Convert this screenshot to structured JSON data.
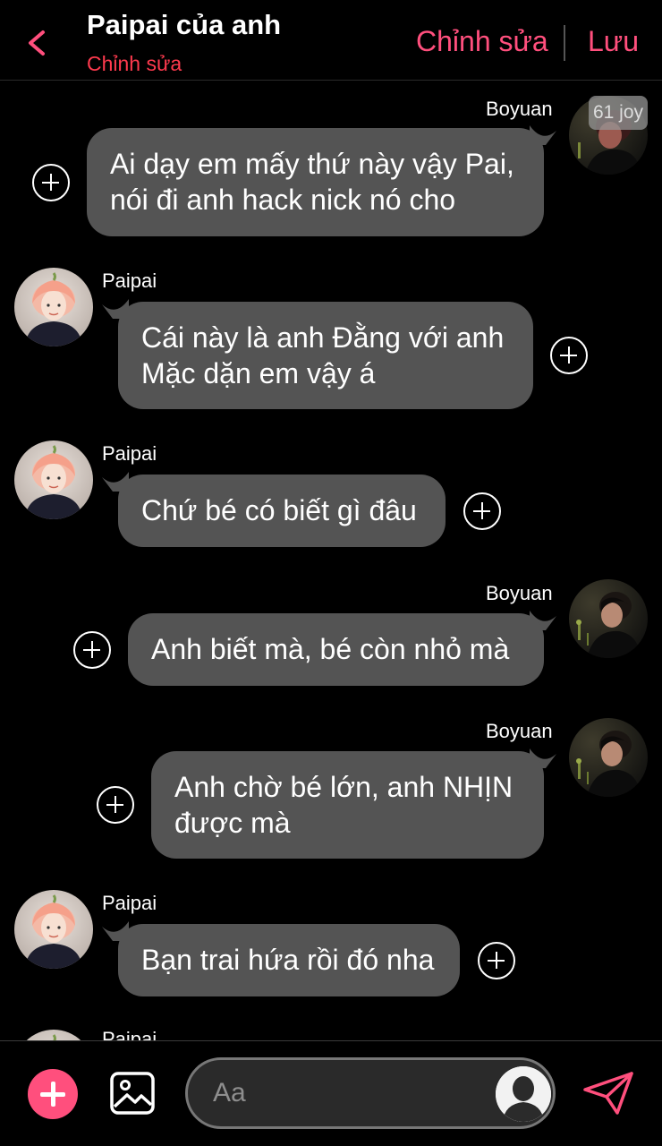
{
  "header": {
    "title": "Paipai của anh",
    "subtitle": "Chỉnh sửa",
    "edit_label": "Chỉnh sửa",
    "save_label": "Lưu"
  },
  "messages": [
    {
      "sender": "Boyuan",
      "side": "right",
      "text": "Ai dạy em mấy thứ này vậy Pai,\nnói đi anh hack nick nó cho",
      "badge": "61 joy"
    },
    {
      "sender": "Paipai",
      "side": "left",
      "text": "Cái này là anh Đằng với anh\nMặc dặn em vậy á"
    },
    {
      "sender": "Paipai",
      "side": "left",
      "text": "Chứ bé có biết gì đâu"
    },
    {
      "sender": "Boyuan",
      "side": "right",
      "text": "Anh biết mà, bé còn nhỏ mà"
    },
    {
      "sender": "Boyuan",
      "side": "right",
      "text": "Anh chờ bé lớn, anh NHỊN\nđược mà"
    },
    {
      "sender": "Paipai",
      "side": "left",
      "text": "Bạn trai hứa rồi đó nha"
    },
    {
      "sender": "Paipai",
      "side": "left",
      "text": ""
    }
  ],
  "composer": {
    "placeholder": "Aa"
  },
  "icons": {
    "back": "chevron-left-icon",
    "add": "plus-icon",
    "image": "image-icon",
    "persona": "person-silhouette-icon",
    "send": "send-paper-plane-icon"
  },
  "colors": {
    "accent": "#ff4f7d",
    "subtitle": "#ff3a4e",
    "bubble": "#545454",
    "background": "#000000"
  }
}
